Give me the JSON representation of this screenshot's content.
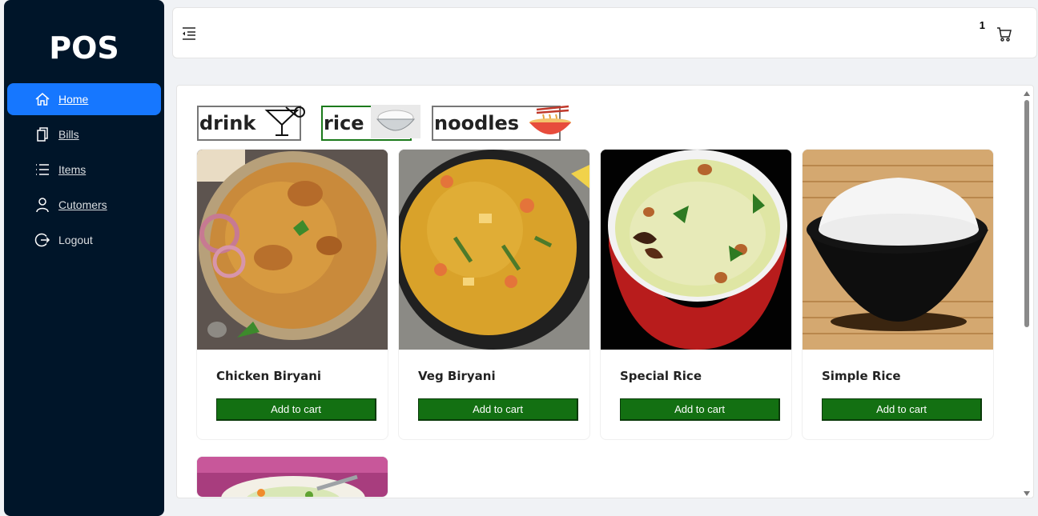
{
  "app": {
    "logo": "POS"
  },
  "sidebar": {
    "items": [
      {
        "label": "Home",
        "icon": "home-icon",
        "active": true
      },
      {
        "label": "Bills",
        "icon": "copy-icon"
      },
      {
        "label": "Items",
        "icon": "list-icon"
      },
      {
        "label": "Cutomers",
        "icon": "user-icon"
      },
      {
        "label": "Logout",
        "icon": "logout-icon"
      }
    ]
  },
  "header": {
    "cart_count": "1",
    "toggle_icon": "menu-fold-icon",
    "cart_icon": "shopping-cart-icon"
  },
  "categories": [
    {
      "name": "drink",
      "icon": "cocktail-glass-icon",
      "active": false
    },
    {
      "name": "rice",
      "icon": "rice-bowl-icon",
      "active": true
    },
    {
      "name": "noodles",
      "icon": "noodle-bowl-icon",
      "active": false
    }
  ],
  "products": [
    {
      "name": "Chicken Biryani",
      "button": "Add to cart"
    },
    {
      "name": "Veg Biryani",
      "button": "Add to cart"
    },
    {
      "name": "Special Rice",
      "button": "Add to cart"
    },
    {
      "name": "Simple Rice",
      "button": "Add to cart"
    }
  ],
  "colors": {
    "sidebar_bg": "#001529",
    "active_menu": "#1677ff",
    "button_green": "#137012",
    "active_category_border": "#1b7a1b"
  }
}
